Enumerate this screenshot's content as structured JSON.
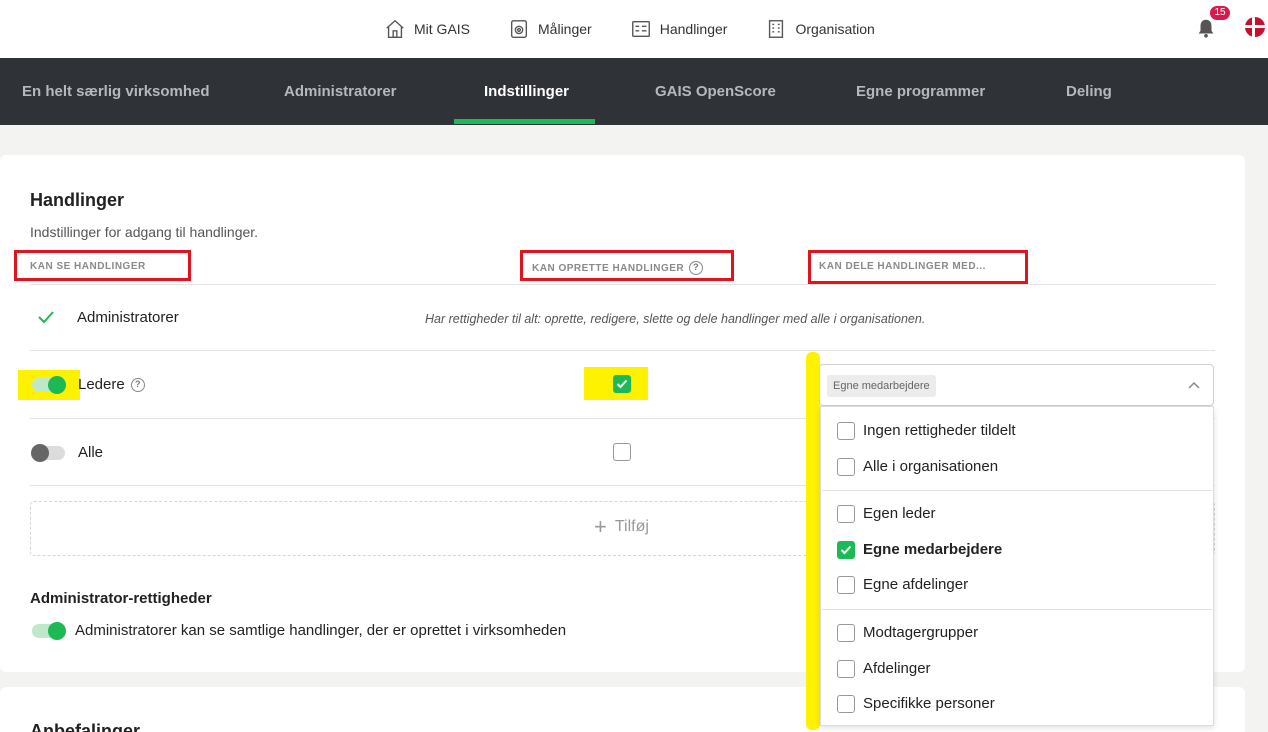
{
  "topnav": {
    "items": [
      {
        "label": "Mit GAIS",
        "icon": "home-icon"
      },
      {
        "label": "Målinger",
        "icon": "survey-icon"
      },
      {
        "label": "Handlinger",
        "icon": "actions-icon"
      },
      {
        "label": "Organisation",
        "icon": "building-icon"
      }
    ],
    "notification_count": "15"
  },
  "subnav": {
    "tabs": [
      {
        "label": "En helt særlig virksomhed"
      },
      {
        "label": "Administratorer"
      },
      {
        "label": "Indstillinger"
      },
      {
        "label": "GAIS OpenScore"
      },
      {
        "label": "Egne programmer"
      },
      {
        "label": "Deling"
      }
    ],
    "active_tab": "Indstillinger"
  },
  "section": {
    "title": "Handlinger",
    "subtitle": "Indstillinger for adgang til handlinger.",
    "col_see": "KAN SE HANDLINGER",
    "col_create": "KAN OPRETTE HANDLINGER",
    "col_share": "KAN DELE HANDLINGER MED..."
  },
  "rows": {
    "admins": {
      "label": "Administratorer",
      "note": "Har rettigheder til alt: oprette, redigere, slette og dele handlinger med alle i organisationen."
    },
    "leaders": {
      "label": "Ledere",
      "see_enabled": true,
      "create_checked": true
    },
    "all": {
      "label": "Alle",
      "see_enabled": false,
      "create_checked": false
    }
  },
  "add": {
    "label": "Tilføj"
  },
  "admin_rights": {
    "title": "Administrator-rettigheder",
    "toggle_label": "Administratorer kan se samtlige handlinger, der er oprettet i virksomheden",
    "enabled": true
  },
  "share_dropdown": {
    "selected_chip": "Egne medarbejdere",
    "options": [
      {
        "label": "Ingen rettigheder tildelt",
        "checked": false
      },
      {
        "label": "Alle i organisationen",
        "checked": false
      },
      {
        "label": "Egen leder",
        "checked": false
      },
      {
        "label": "Egne medarbejdere",
        "checked": true
      },
      {
        "label": "Egne afdelinger",
        "checked": false
      },
      {
        "label": "Modtagergrupper",
        "checked": false
      },
      {
        "label": "Afdelinger",
        "checked": false
      },
      {
        "label": "Specifikke personer",
        "checked": false
      }
    ]
  },
  "next_section": {
    "title": "Anbefalinger"
  },
  "colors": {
    "accent": "#1db954",
    "nav_dark": "#2f3237",
    "highlight_box": "#e0141e",
    "marker": "#fff200",
    "badge": "#d7194c"
  }
}
